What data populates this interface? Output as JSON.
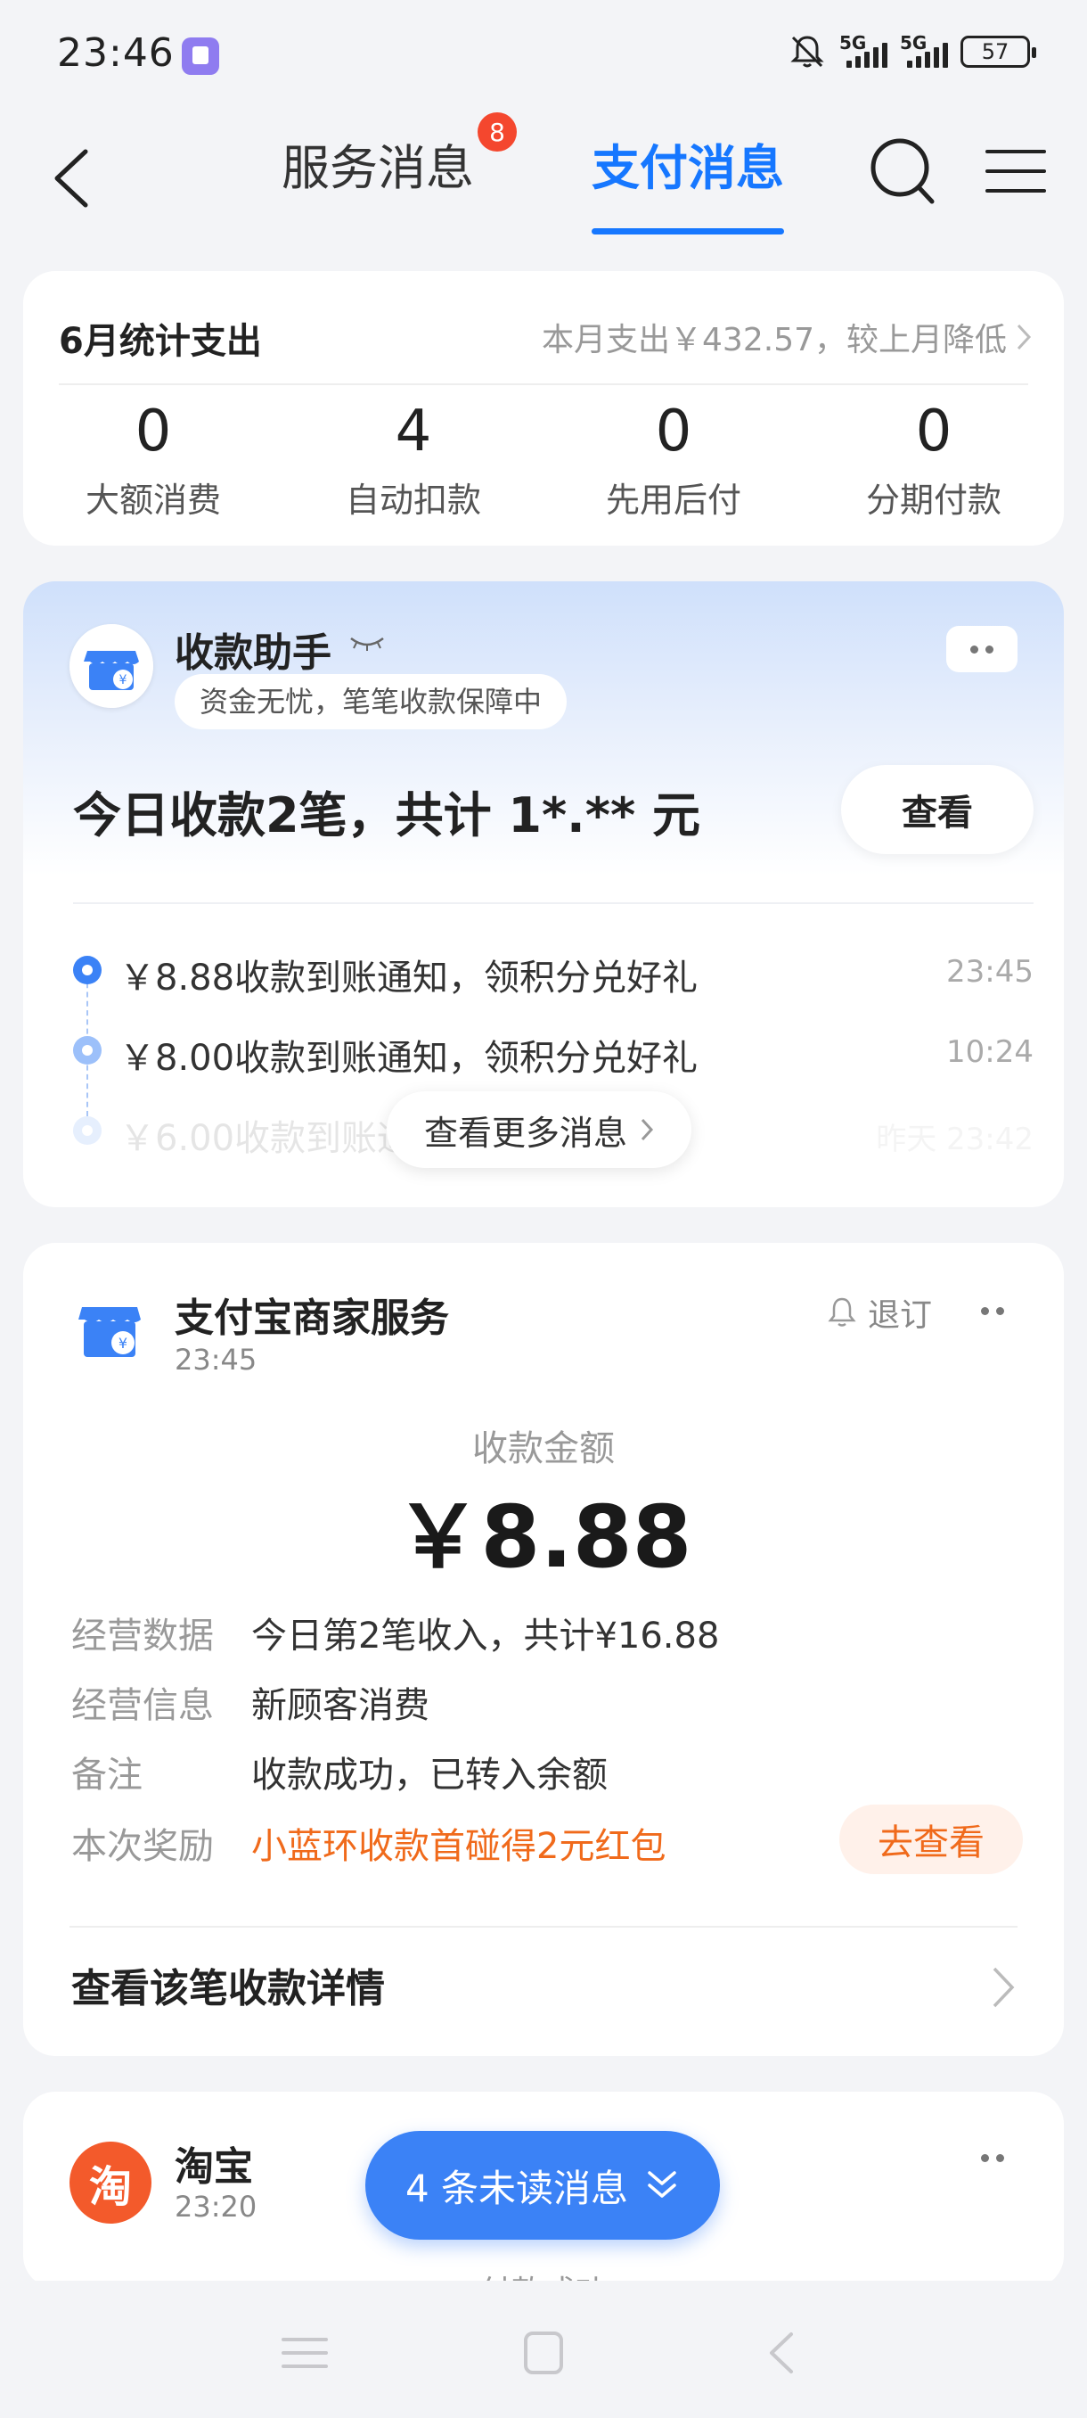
{
  "status_bar": {
    "time": "23:46",
    "signal1_label": "5G",
    "signal2_label": "5G",
    "battery": "57"
  },
  "nav": {
    "tab_service": "服务消息",
    "service_badge": "8",
    "tab_payment": "支付消息"
  },
  "stats": {
    "title": "6月统计支出",
    "summary": "本月支出￥432.57，较上月降低",
    "items": [
      {
        "value": "0",
        "label": "大额消费"
      },
      {
        "value": "4",
        "label": "自动扣款"
      },
      {
        "value": "0",
        "label": "先用后付"
      },
      {
        "value": "0",
        "label": "分期付款"
      }
    ]
  },
  "assistant": {
    "name": "收款助手",
    "slogan": "资金无忧，笔笔收款保障中",
    "today": "今日收款2笔，共计 1*.** 元",
    "view_button": "查看",
    "messages": [
      {
        "text": "￥8.88收款到账通知，领积分兑好礼",
        "time": "23:45"
      },
      {
        "text": "￥8.00收款到账通知，领积分兑好礼",
        "time": "10:24"
      },
      {
        "text": "￥6.00收款到账通",
        "time": "昨天 23:42"
      }
    ],
    "see_more": "查看更多消息"
  },
  "merchant": {
    "name": "支付宝商家服务",
    "time": "23:45",
    "unsubscribe": "退订",
    "amount_label": "收款金额",
    "amount": "￥8.88",
    "rows": [
      {
        "key": "经营数据",
        "value": "今日第2笔收入，共计¥16.88"
      },
      {
        "key": "经营信息",
        "value": "新顾客消费"
      },
      {
        "key": "备注",
        "value": "收款成功，已转入余额"
      },
      {
        "key": "本次奖励",
        "value": "小蓝环收款首碰得2元红包"
      }
    ],
    "go_button": "去查看",
    "detail_link": "查看该笔收款详情"
  },
  "taobao": {
    "logo_text": "淘",
    "name": "淘宝",
    "time": "23:20",
    "partial_text": "付款成功"
  },
  "unread_pill": "4 条未读消息",
  "colors": {
    "accent": "#1677ff",
    "badge": "#f4472e",
    "orange": "#f06a1b"
  }
}
